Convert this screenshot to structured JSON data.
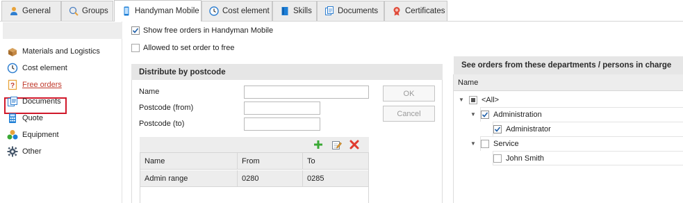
{
  "tabs": [
    {
      "label": "General",
      "icon": "person-icon"
    },
    {
      "label": "Groups",
      "icon": "groups-icon"
    },
    {
      "label": "Handyman Mobile",
      "icon": "mobile-icon"
    },
    {
      "label": "Cost element",
      "icon": "clock-icon"
    },
    {
      "label": "Skills",
      "icon": "book-icon"
    },
    {
      "label": "Documents",
      "icon": "documents-icon"
    },
    {
      "label": "Certificates",
      "icon": "certificate-icon"
    }
  ],
  "active_tab": "Handyman Mobile",
  "sidebar": {
    "items": [
      {
        "label": "Materials and Logistics",
        "icon": "boxes-icon"
      },
      {
        "label": "Cost element",
        "icon": "clock-icon"
      },
      {
        "label": "Free orders",
        "icon": "question-doc-icon"
      },
      {
        "label": "Documents",
        "icon": "documents-icon"
      },
      {
        "label": "Quote",
        "icon": "calculator-icon"
      },
      {
        "label": "Equipment",
        "icon": "equipment-icon"
      },
      {
        "label": "Other",
        "icon": "gear-icon"
      }
    ],
    "selected": "Free orders"
  },
  "options": {
    "show_free_orders": {
      "label": "Show free orders in Handyman Mobile",
      "checked": true
    },
    "allowed_set_free": {
      "label": "Allowed to set order to free",
      "checked": false
    }
  },
  "distribute": {
    "title": "Distribute by postcode",
    "name_label": "Name",
    "name_value": "",
    "postcode_from_label": "Postcode (from)",
    "postcode_from_value": "",
    "postcode_to_label": "Postcode (to)",
    "postcode_to_value": "",
    "ok_label": "OK",
    "cancel_label": "Cancel",
    "toolbar": [
      "add-icon",
      "edit-icon",
      "delete-icon"
    ],
    "columns": [
      "Name",
      "From",
      "To"
    ],
    "rows": [
      {
        "name": "Admin range",
        "from": "0280",
        "to": "0285"
      }
    ]
  },
  "departments": {
    "title": "See orders from these departments / persons in charge",
    "column": "Name",
    "tree": [
      {
        "label": "<All>",
        "level": 0,
        "state": "partial",
        "expanded": true
      },
      {
        "label": "Administration",
        "level": 1,
        "state": "checked",
        "expanded": true
      },
      {
        "label": "Administrator",
        "level": 2,
        "state": "checked"
      },
      {
        "label": "Service",
        "level": 1,
        "state": "unchecked",
        "expanded": true
      },
      {
        "label": "John Smith",
        "level": 2,
        "state": "unchecked"
      }
    ]
  },
  "colors": {
    "accent_blue": "#1e7fd6",
    "selection_red": "#d0182a",
    "add_green": "#3aa935",
    "delete_red": "#e03a2f"
  }
}
